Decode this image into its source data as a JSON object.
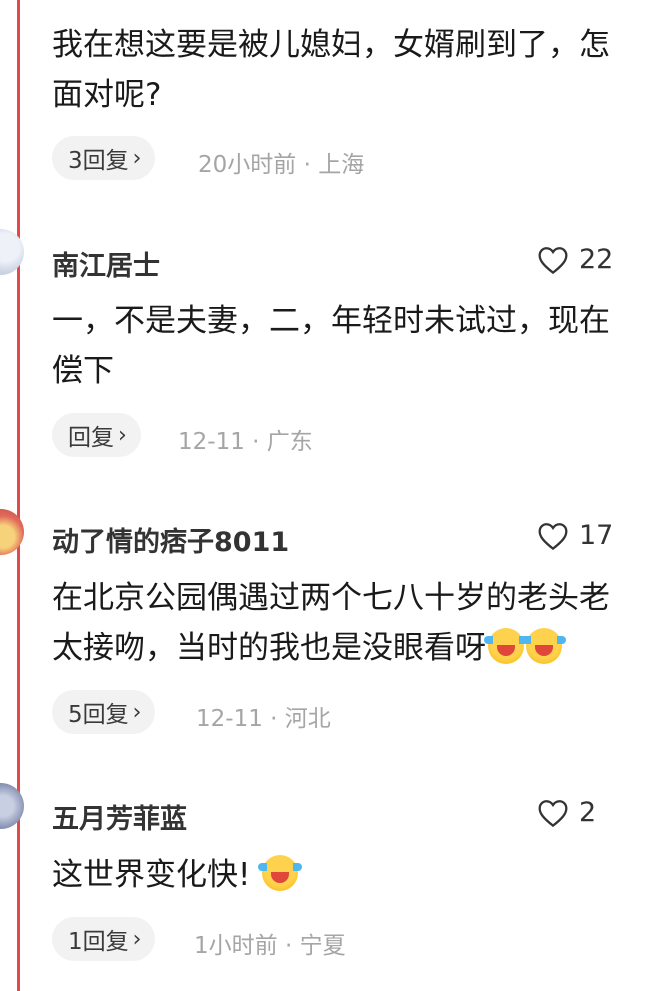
{
  "comments": [
    {
      "lines": [
        "我在想这要是被儿媳妇，女婿刷到了，怎",
        "面对呢?"
      ],
      "reply_label": "3回复",
      "meta": "20小时前 · 上海"
    },
    {
      "username": "南江居士",
      "likes": "22",
      "lines": [
        "一，不是夫妻，二，年轻时未试过，现在",
        "偿下"
      ],
      "reply_label": "回复",
      "meta": "12-11 · 广东"
    },
    {
      "username": "动了情的痞子8011",
      "likes": "17",
      "lines": [
        "在北京公园偶遇过两个七八十岁的老头老",
        "太接吻，当时的我也是没眼看呀"
      ],
      "reply_label": "5回复",
      "meta": "12-11 · 河北"
    },
    {
      "username": "五月芳菲蓝",
      "likes": "2",
      "lines": [
        "这世界变化快!"
      ],
      "reply_label": "1回复",
      "meta": "1小时前 · 宁夏"
    }
  ],
  "icons": {
    "like": "heart-outline-icon",
    "reply_chevron": "chevron-right-icon",
    "emoji": "laughing-crying-emoji"
  }
}
